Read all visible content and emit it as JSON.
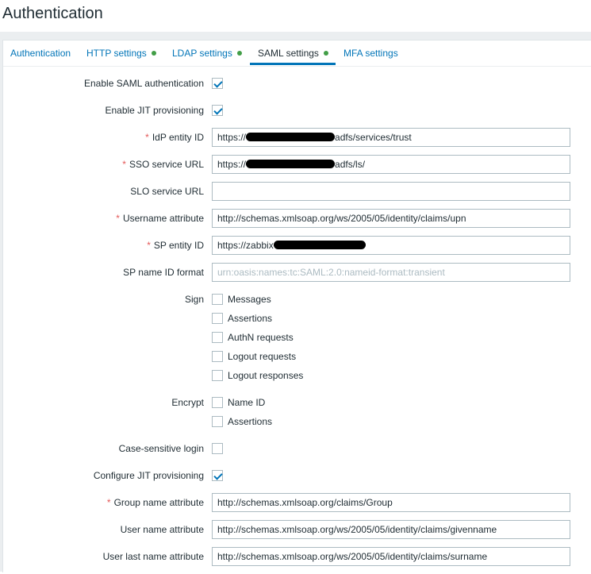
{
  "page_title": "Authentication",
  "tabs": [
    {
      "label": "Authentication",
      "dot": false
    },
    {
      "label": "HTTP settings",
      "dot": true
    },
    {
      "label": "LDAP settings",
      "dot": true
    },
    {
      "label": "SAML settings",
      "dot": true,
      "active": true
    },
    {
      "label": "MFA settings",
      "dot": false
    }
  ],
  "form": {
    "enable_saml": {
      "label": "Enable SAML authentication",
      "checked": true
    },
    "enable_jit": {
      "label": "Enable JIT provisioning",
      "checked": true
    },
    "idp_entity_id": {
      "label": "IdP entity ID",
      "prefix": "https://",
      "suffix": "adfs/services/trust"
    },
    "sso_url": {
      "label": "SSO service URL",
      "prefix": "https://",
      "suffix": "adfs/ls/"
    },
    "slo_url": {
      "label": "SLO service URL",
      "value": ""
    },
    "username_attr": {
      "label": "Username attribute",
      "value": "http://schemas.xmlsoap.org/ws/2005/05/identity/claims/upn"
    },
    "sp_entity_id": {
      "label": "SP entity ID",
      "prefix": "https://zabbix",
      "suffix": ""
    },
    "sp_name_id_format": {
      "label": "SP name ID format",
      "placeholder": "urn:oasis:names:tc:SAML:2.0:nameid-format:transient"
    },
    "sign": {
      "label": "Sign",
      "options": [
        "Messages",
        "Assertions",
        "AuthN requests",
        "Logout requests",
        "Logout responses"
      ]
    },
    "encrypt": {
      "label": "Encrypt",
      "options": [
        "Name ID",
        "Assertions"
      ]
    },
    "case_sensitive": {
      "label": "Case-sensitive login",
      "checked": false
    },
    "configure_jit": {
      "label": "Configure JIT provisioning",
      "checked": true
    },
    "group_name_attr": {
      "label": "Group name attribute",
      "value": "http://schemas.xmlsoap.org/claims/Group"
    },
    "user_name_attr": {
      "label": "User name attribute",
      "value": "http://schemas.xmlsoap.org/ws/2005/05/identity/claims/givenname"
    },
    "user_last_name_attr": {
      "label": "User last name attribute",
      "value": "http://schemas.xmlsoap.org/ws/2005/05/identity/claims/surname"
    }
  },
  "colors": {
    "accent": "#0275b8",
    "ok_dot": "#429e47",
    "required": "#e45959"
  }
}
